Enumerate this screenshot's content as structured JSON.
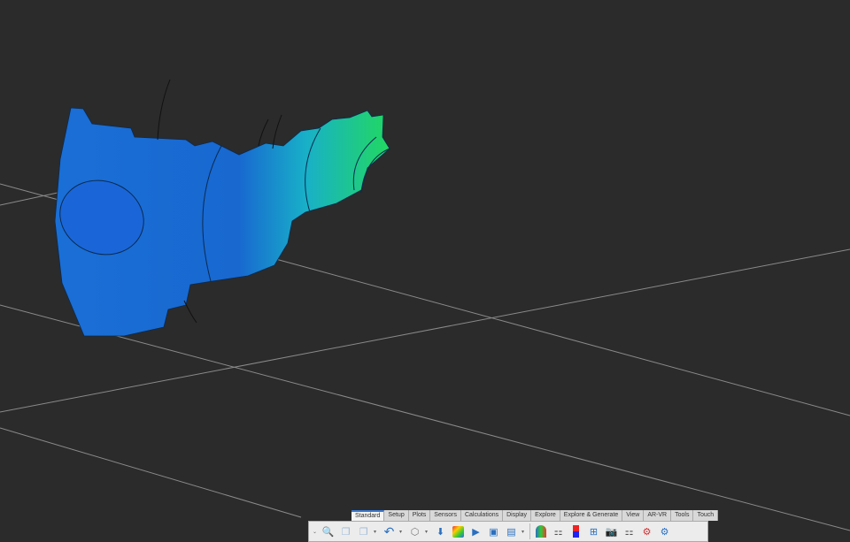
{
  "tabs": [
    {
      "label": "Standard",
      "active": true
    },
    {
      "label": "Setup"
    },
    {
      "label": "Plots"
    },
    {
      "label": "Sensors"
    },
    {
      "label": "Calculations"
    },
    {
      "label": "Display"
    },
    {
      "label": "Explore"
    },
    {
      "label": "Explore & Generate"
    },
    {
      "label": "View"
    },
    {
      "label": "AR-VR"
    },
    {
      "label": "Tools"
    },
    {
      "label": "Touch"
    }
  ],
  "toolbar_icons": [
    "collapse-chevron",
    "zoom-fit",
    "copy",
    "paste",
    "undo",
    "part-geometry",
    "import-geometry",
    "results-contour",
    "animation",
    "presentation",
    "window-layout",
    "section-cut",
    "vector-plot",
    "legend",
    "view-layout",
    "camera",
    "multi-view",
    "result-settings",
    "view-settings"
  ],
  "colors": {
    "background": "#2b2b2b",
    "accent": "#3a7bd5"
  }
}
